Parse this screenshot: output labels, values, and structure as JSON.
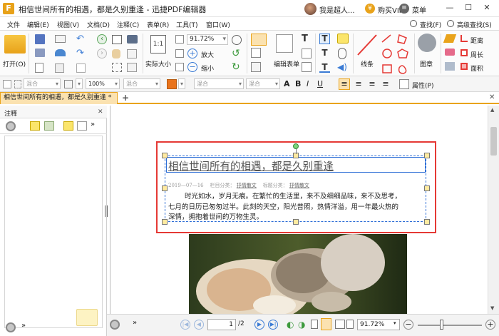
{
  "window": {
    "title": "相信世间所有的相遇，都是久别重逢 - 迅捷PDF编辑器",
    "user_name": "我是超人...",
    "vip_label": "购买VIP",
    "menu_label": "菜单"
  },
  "menubar": {
    "items": [
      "文件",
      "编辑(E)",
      "视图(V)",
      "文档(D)",
      "注释(C)",
      "表单(R)",
      "工具(T)",
      "窗口(W)"
    ],
    "search": "查找(F)",
    "advanced_search": "高级查找(S)"
  },
  "toolbar": {
    "open": "打开(O)",
    "actual_size": "实际大小",
    "zoom": "91.72%",
    "zoom_in": "放大",
    "zoom_out": "缩小",
    "edit_form": "编辑表单",
    "lines": "线条",
    "stamp": "图章",
    "distance": "距离",
    "perimeter": "周长",
    "area": "面积"
  },
  "fmtbar": {
    "blend1": "混合",
    "opacity": "100%",
    "blend2": "混合",
    "blend3": "混合",
    "blend4": "混合",
    "properties": "属性(P)"
  },
  "tab": {
    "label": "相信世间所有的相遇，都是久别重逢 *"
  },
  "left_panel": {
    "title": "注释"
  },
  "document": {
    "heading": "相信世间所有的相遇，都是久别重逢",
    "meta_date": "2019—07—16",
    "meta_col_label": "栏目分类：",
    "meta_col": "抒情散文",
    "meta_tag_label": "标题分类：",
    "meta_tag": "抒情散文",
    "body_line1": "时光如水，岁月无痕。在繁忙的生活里，来不及细细品味，来不及思考，",
    "body_line2": "七月的日历已匆匆过半。此刻的天空，阳光普照，热情洋溢，用一年最火热的",
    "body_line3": "深情，拥抱着世间的万物生灵。"
  },
  "statusbar": {
    "page_input": "1",
    "page_total": "/2",
    "zoom": "91.72%"
  },
  "colors": {
    "accent": "#e9a31b",
    "selection_red": "#e53935",
    "selection_blue": "#2f6fd6"
  }
}
